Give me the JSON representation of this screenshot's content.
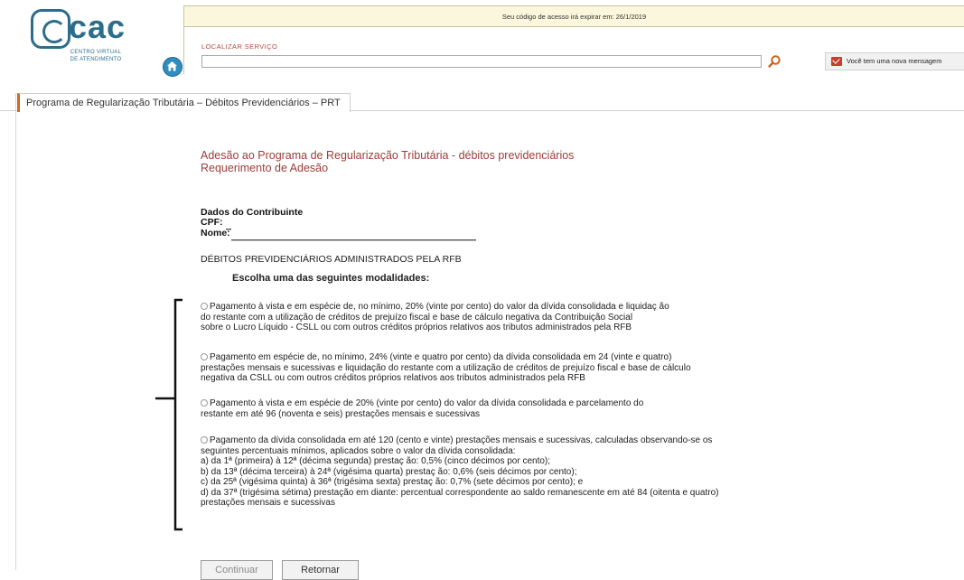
{
  "header": {
    "logo_text": "cac",
    "logo_subtitle_1": "CENTRO VIRTUAL",
    "logo_subtitle_2": "DE ATENDIMENTO",
    "access_notice": "Seu código de acesso irá expirar em: 26/1/2019",
    "locate_label": "LOCALIZAR SERVIÇO",
    "locate_value": "",
    "message_text": "Você tem uma nova mensagem"
  },
  "tab": {
    "label": "Programa de Regularização Tributária – Débitos Previdenciários – PRT"
  },
  "main": {
    "title_1": "Adesão ao Programa de Regularização Tributária - débitos previdenciários",
    "title_2": "Requerimento de Adesão",
    "contributor_heading": "Dados do Contribuinte",
    "cpf_label": "CPF:",
    "name_label": "Nome:",
    "debts_heading": "DÉBITOS PREVIDENCIÁRIOS ADMINISTRADOS PELA RFB",
    "choose_label": "Escolha uma das seguintes modalidades:",
    "options": [
      {
        "lines": [
          "Pagamento à vista e em espécie de, no mínimo, 20% (vinte por cento) do valor da dívida consolidada e liquidaç ão",
          "do restante com a utilização de créditos de prejuízo fiscal e base de cálculo negativa da Contribuição Social",
          "sobre o Lucro Líquido - CSLL ou com outros créditos próprios relativos aos tributos administrados pela RFB"
        ]
      },
      {
        "lines": [
          "Pagamento em espécie de, no mínimo, 24% (vinte e quatro por cento) da dívida consolidada em 24 (vinte e quatro)",
          "prestações mensais e sucessivas e liquidação do restante com a utilização de créditos de prejuízo fiscal e base de cálculo",
          "negativa da CSLL ou com outros créditos próprios relativos aos tributos administrados pela RFB"
        ]
      },
      {
        "lines": [
          "Pagamento à vista e em espécie de 20% (vinte por cento) do valor da dívida consolidada e parcelamento do",
          "restante em até 96 (noventa e seis) prestações mensais e sucessivas"
        ]
      },
      {
        "lines": [
          "Pagamento da dívida consolidada em até 120 (cento e vinte) prestações mensais e sucessivas, calculadas observando-se os",
          "seguintes percentuais mínimos, aplicados sobre o valor da dívida consolidada:",
          "a) da 1ª (primeira) à 12ª (décima segunda) prestaç ão: 0,5% (cinco décimos por cento);",
          "b) da 13ª (décima terceira) à 24ª (vigésima quarta) prestaç ão: 0,6% (seis décimos por cento);",
          "c) da 25ª (vigésima quinta) à 36ª (trigésima sexta) prestaç ão: 0,7% (sete décimos por cento); e",
          "d) da 37ª (trigésima sétima) prestação em diante: percentual correspondente ao saldo remanescente em até 84 (oitenta e quatro)",
          "prestações mensais e sucessivas"
        ]
      }
    ],
    "continue_label": "Continuar",
    "return_label": "Retornar"
  }
}
